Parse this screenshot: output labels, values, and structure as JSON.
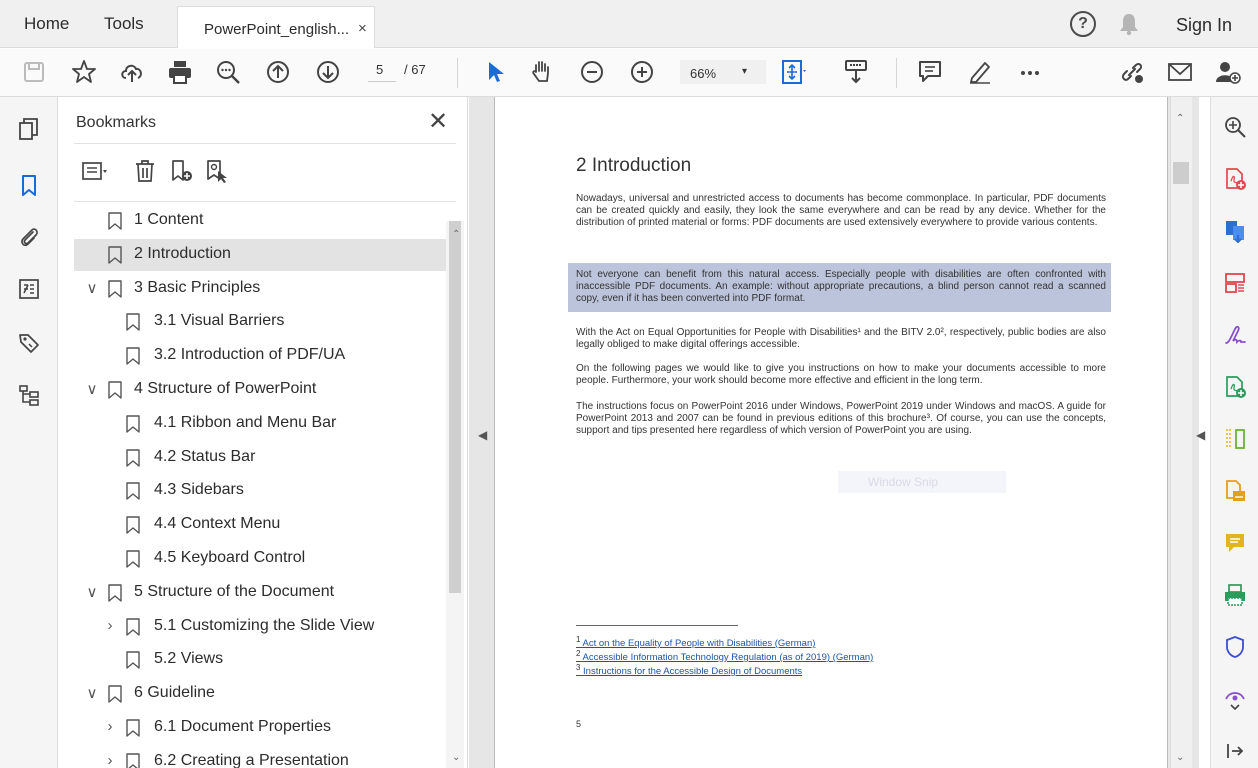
{
  "menubar": {
    "home": "Home",
    "tools": "Tools",
    "tab_title": "PowerPoint_english...",
    "tab_close": "×",
    "help": "?",
    "sign_in": "Sign In"
  },
  "toolbar": {
    "current_page": "5",
    "page_total": "/ 67",
    "zoom": "66%",
    "zoom_caret": "▾"
  },
  "bookmarks": {
    "title": "Bookmarks",
    "close": "✕",
    "items": [
      {
        "label": "1 Content",
        "chevron": ""
      },
      {
        "label": "2 Introduction",
        "chevron": ""
      },
      {
        "label": "3 Basic Principles",
        "chevron": "∨"
      },
      {
        "label": "3.1 Visual Barriers",
        "chevron": ""
      },
      {
        "label": "3.2 Introduction of PDF/UA",
        "chevron": ""
      },
      {
        "label": "4 Structure of PowerPoint",
        "chevron": "∨"
      },
      {
        "label": "4.1 Ribbon and Menu Bar",
        "chevron": ""
      },
      {
        "label": "4.2 Status Bar",
        "chevron": ""
      },
      {
        "label": "4.3 Sidebars",
        "chevron": ""
      },
      {
        "label": "4.4 Context Menu",
        "chevron": ""
      },
      {
        "label": "4.5 Keyboard Control",
        "chevron": ""
      },
      {
        "label": "5 Structure of the Document",
        "chevron": "∨"
      },
      {
        "label": "5.1 Customizing the Slide View",
        "chevron": "›"
      },
      {
        "label": "5.2 Views",
        "chevron": ""
      },
      {
        "label": "6 Guideline",
        "chevron": "∨"
      },
      {
        "label": "6.1 Document Properties",
        "chevron": "›"
      },
      {
        "label": "6.2 Creating a Presentation",
        "chevron": "›"
      }
    ]
  },
  "page": {
    "heading": "2  Introduction",
    "para1": "Nowadays, universal and unrestricted access to documents has become commonplace. In particular, PDF documents can be created quickly and easily, they look the same everywhere and can be read by any device. Whether for the distribution of printed material or forms: PDF documents are used extensively everywhere to provide various contents.",
    "para2": "Not everyone can benefit from this natural access. Especially people with disabilities are often confronted with inaccessible PDF documents. An example: without appropriate precautions, a blind person cannot read a scanned copy, even if it has been converted into PDF format.",
    "para3": "With the Act on Equal Opportunities for People with Disabilities¹ and the BITV 2.0², respectively, public bodies are also legally obliged to make digital offerings accessible.",
    "para4": "On the following pages we would like to give you instructions on how to make your documents accessible to more people. Furthermore, your work should become more effective and efficient in the long term.",
    "para5": "The instructions focus on PowerPoint 2016 under Windows, PowerPoint 2019 under Windows and macOS. A guide for PowerPoint 2013 and 2007 can be found in previous editions of this brochure³. Of course, you can use the concepts, support and tips presented here regardless of which version of PowerPoint you are using.",
    "ghost_label": "Window Snip",
    "footnotes": [
      {
        "num": "1",
        "text": "Act on the Equality of People with Disabilities (German)"
      },
      {
        "num": "2",
        "text": "Accessible Information Technology Regulation (as of 2019) (German)"
      },
      {
        "num": "3",
        "text": "Instructions for the Accessible Design of Documents"
      }
    ],
    "page_number": "5"
  },
  "colors": {
    "accent_blue": "#1a6ad9",
    "acrobat_red": "#e34850",
    "highlight": "#bcc4db"
  }
}
